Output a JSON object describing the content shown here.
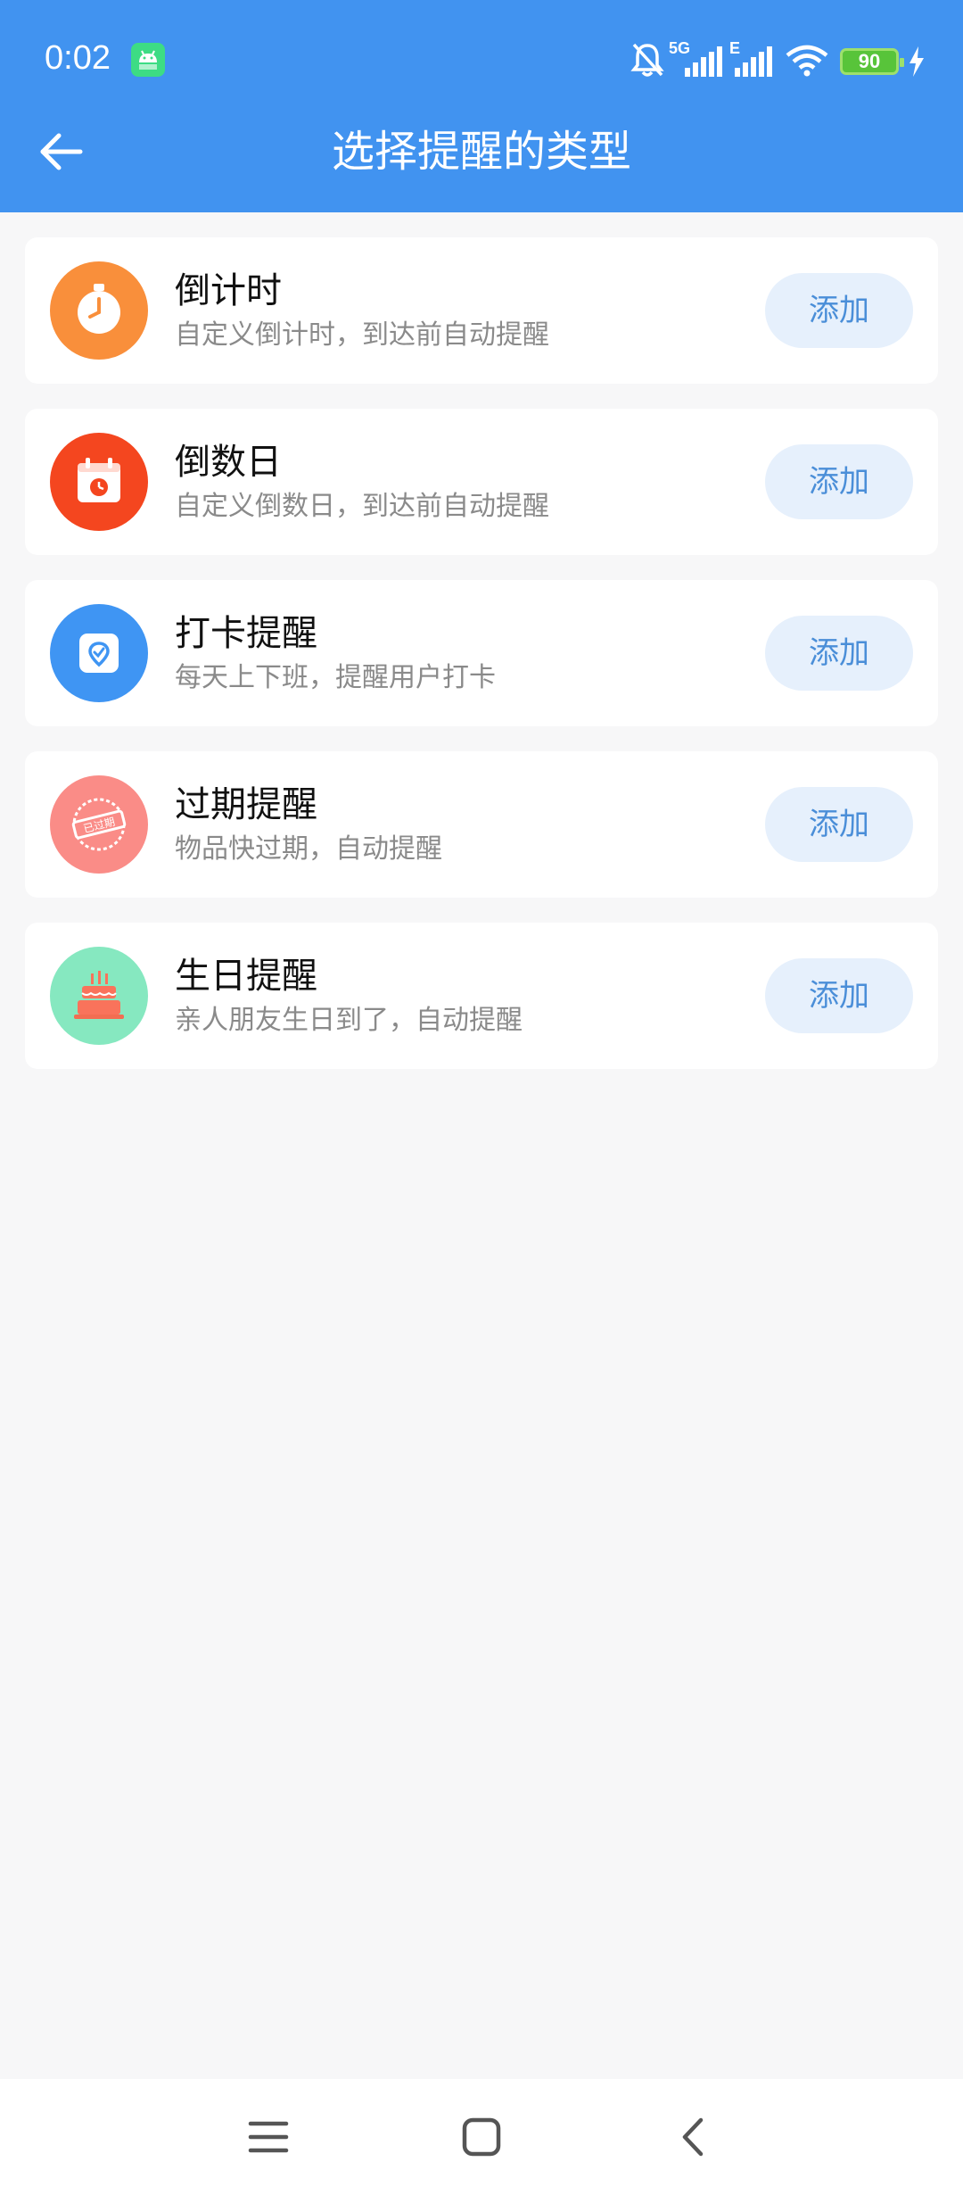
{
  "status": {
    "time": "0:02",
    "network_5g": "5G",
    "network_e": "E",
    "battery": "90"
  },
  "header": {
    "title": "选择提醒的类型"
  },
  "reminder_types": [
    {
      "title": "倒计时",
      "desc": "自定义倒计时，到达前自动提醒",
      "add_label": "添加",
      "icon": "stopwatch-icon",
      "color": "#f98f3b"
    },
    {
      "title": "倒数日",
      "desc": "自定义倒数日，到达前自动提醒",
      "add_label": "添加",
      "icon": "calendar-icon",
      "color": "#f4461f"
    },
    {
      "title": "打卡提醒",
      "desc": "每天上下班，提醒用户打卡",
      "add_label": "添加",
      "icon": "location-pin-icon",
      "color": "#3f95f3"
    },
    {
      "title": "过期提醒",
      "desc": "物品快过期，自动提醒",
      "add_label": "添加",
      "icon": "expired-stamp-icon",
      "color": "#fa8c87"
    },
    {
      "title": "生日提醒",
      "desc": "亲人朋友生日到了，自动提醒",
      "add_label": "添加",
      "icon": "birthday-cake-icon",
      "color": "#86e8c0"
    }
  ],
  "expired_stamp_text": "已过期",
  "colors": {
    "appbar": "#4193f0",
    "add_button_bg": "#e6f0fc",
    "add_button_text": "#4a8ed8"
  }
}
